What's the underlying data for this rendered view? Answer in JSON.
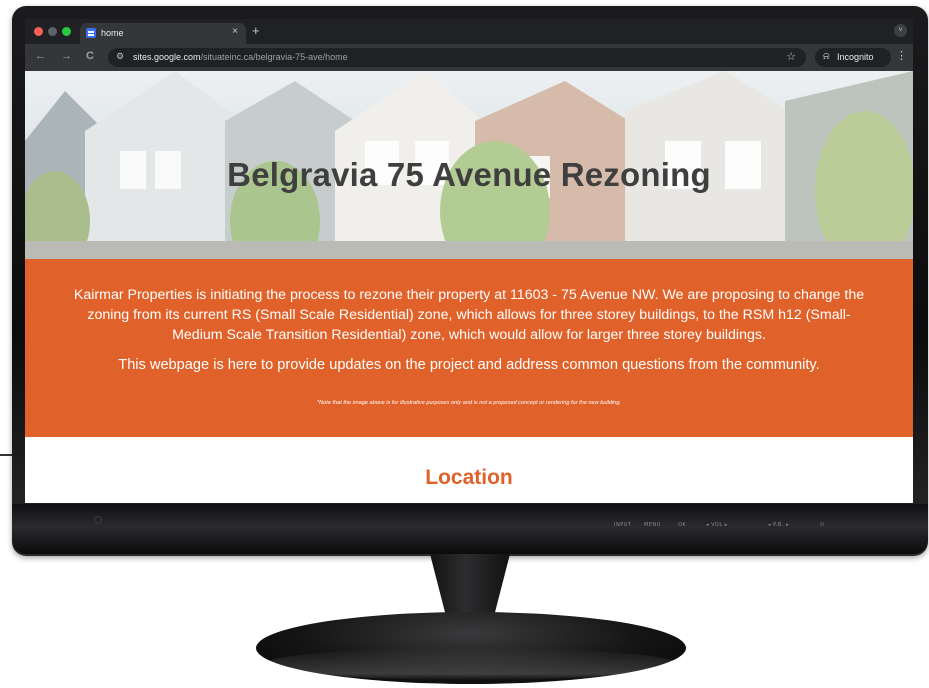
{
  "browser": {
    "tab_title": "home",
    "tab_close": "×",
    "new_tab": "+",
    "url_host": "sites.google.com",
    "url_path": "/situateinc.ca/belgravia-75-ave/home",
    "incognito_label": "Incognito",
    "back_icon": "←",
    "forward_icon": "→",
    "reload_icon": "C",
    "star_icon": "☆",
    "menu_icon": "⋮",
    "tabs_menu_icon": "˅",
    "site_info_icon": "⚙",
    "incognito_icon": "⍾"
  },
  "page": {
    "hero_title": "Belgravia 75 Avenue Rezoning",
    "intro": "Kairmar Properties is initiating the process to rezone their property at 11603 - 75 Avenue NW. We are proposing to change the zoning from its current RS (Small Scale Residential) zone, which allows for three storey buildings, to the RSM h12 (Small-Medium Scale Transition Residential) zone, which would allow for larger three storey buildings.",
    "purpose": "This webpage is here to provide updates on the project and address common questions from the community.",
    "note": "*Note that the image above is for illustrative purposes only and is not a proposed concept or rendering for the new building.",
    "location_heading": "Location"
  },
  "monitor": {
    "controls": [
      "INPUT",
      "MENU",
      "OK",
      "◂ VOL ▸",
      "◂ P.B. ▸",
      "⏻"
    ]
  },
  "colors": {
    "accent": "#e0622a",
    "browser_dark": "#202124",
    "browser_toolbar": "#35363a",
    "close_light": "#ff5f57",
    "min_light": "#5f6368",
    "max_light": "#28c840"
  }
}
